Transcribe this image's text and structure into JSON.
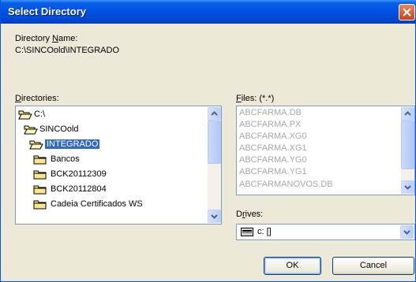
{
  "window": {
    "title": "Select Directory"
  },
  "directory_name": {
    "label_pre": "Directory ",
    "label_u": "N",
    "label_post": "ame:",
    "value": "C:\\SINCOold\\INTEGRADO"
  },
  "directories": {
    "label_u": "D",
    "label_post": "irectories:",
    "items": [
      {
        "label": "C:\\",
        "icon": "open-folder-icon"
      },
      {
        "label": "SINCOold",
        "icon": "open-folder-icon"
      },
      {
        "label": "INTEGRADO",
        "icon": "open-folder-icon",
        "selected": true
      },
      {
        "label": "Bancos",
        "icon": "folder-icon"
      },
      {
        "label": "BCK20112309",
        "icon": "folder-icon"
      },
      {
        "label": "BCK20112804",
        "icon": "folder-icon"
      },
      {
        "label": "Cadeia Certificados WS",
        "icon": "folder-icon"
      }
    ]
  },
  "files": {
    "label_u": "F",
    "label_post": "iles: (*.*)",
    "items": [
      "ABCFARMA.DB",
      "ABCFARMA.PX",
      "ABCFARMA.XG0",
      "ABCFARMA.XG1",
      "ABCFARMA.YG0",
      "ABCFARMA.YG1",
      "ABCFARMANOVOS.DB"
    ]
  },
  "drives": {
    "label_pre": "D",
    "label_u": "r",
    "label_post": "ives:",
    "value": "c: []",
    "icon": "drive-icon"
  },
  "buttons": {
    "ok": "OK",
    "cancel": "Cancel"
  },
  "colors": {
    "titlebar": "#0055e5",
    "selection": "#316ac5",
    "window_bg": "#ece9d8",
    "close": "#d9522c"
  }
}
